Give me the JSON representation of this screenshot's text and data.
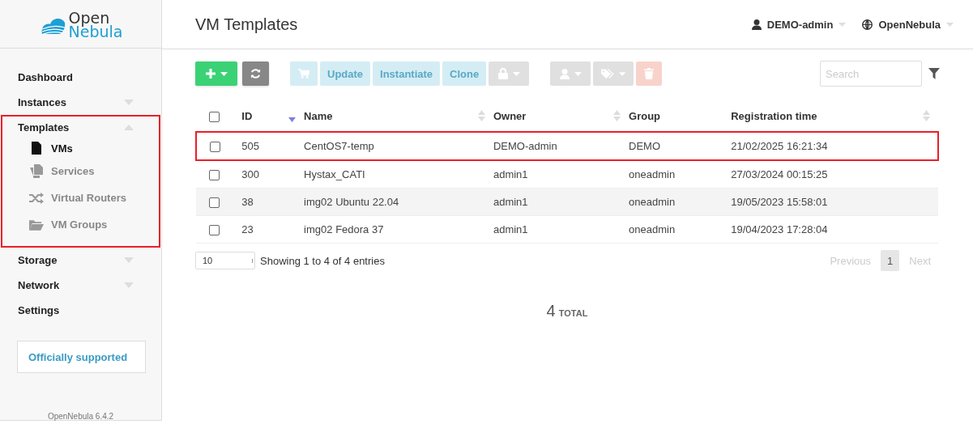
{
  "logo": {
    "line1": "Open",
    "line2": "Nebula"
  },
  "sidebar": {
    "items": [
      {
        "label": "Dashboard",
        "highlighted": false
      },
      {
        "label": "Instances",
        "expanded": false,
        "highlighted": false
      },
      {
        "label": "Templates",
        "expanded": true,
        "highlighted": true,
        "children": [
          {
            "label": "VMs",
            "kind": "file",
            "selected": true
          },
          {
            "label": "Services",
            "kind": "copy",
            "selected": false
          },
          {
            "label": "Virtual Routers",
            "kind": "shuffle",
            "selected": false
          },
          {
            "label": "VM Groups",
            "kind": "folder",
            "selected": false
          }
        ]
      },
      {
        "label": "Storage",
        "expanded": false,
        "highlighted": false
      },
      {
        "label": "Network",
        "expanded": false,
        "highlighted": false
      },
      {
        "label": "Settings",
        "highlighted": false
      }
    ],
    "support": "Officially supported",
    "version": "OpenNebula 6.4.2"
  },
  "header": {
    "title": "VM Templates",
    "user": "DEMO-admin",
    "zone": "OpenNebula"
  },
  "toolbar": [
    {
      "kind": "create",
      "disabled": false
    },
    {
      "kind": "refresh",
      "disabled": false
    },
    {
      "kind": "cart",
      "disabled": true
    },
    {
      "kind": "text",
      "label": "Update",
      "disabled": true
    },
    {
      "kind": "text",
      "label": "Instantiate",
      "disabled": true
    },
    {
      "kind": "text",
      "label": "Clone",
      "disabled": true
    },
    {
      "kind": "lock",
      "disabled": true
    },
    {
      "kind": "user",
      "disabled": true
    },
    {
      "kind": "tag",
      "disabled": true
    },
    {
      "kind": "delete",
      "disabled": true
    }
  ],
  "search": {
    "placeholder": "Search"
  },
  "table": {
    "select_all_checked": false,
    "columns": [
      {
        "label": "ID",
        "sortable": true,
        "sorted": true
      },
      {
        "label": "Name",
        "sortable": true,
        "sorted": false
      },
      {
        "label": "Owner",
        "sortable": true,
        "sorted": false
      },
      {
        "label": "Group",
        "sortable": false,
        "sorted": false
      },
      {
        "label": "Registration time",
        "sortable": true,
        "sorted": false
      }
    ],
    "rows": [
      {
        "checked": false,
        "shaded": false,
        "highlighted": true,
        "cells": [
          "505",
          "CentOS7-temp",
          "DEMO-admin",
          "DEMO",
          "21/02/2025 16:21:34"
        ]
      },
      {
        "checked": false,
        "shaded": false,
        "highlighted": false,
        "cells": [
          "300",
          "Hystax_CATI",
          "admin1",
          "oneadmin",
          "27/03/2024 00:15:25"
        ]
      },
      {
        "checked": false,
        "shaded": true,
        "highlighted": false,
        "cells": [
          "38",
          "img02 Ubuntu 22.04",
          "admin1",
          "oneadmin",
          "19/05/2023 15:58:01"
        ]
      },
      {
        "checked": false,
        "shaded": false,
        "highlighted": false,
        "cells": [
          "23",
          "img02 Fedora 37",
          "admin1",
          "oneadmin",
          "19/04/2023 17:28:04"
        ]
      }
    ]
  },
  "footer": {
    "page_size": "10",
    "info": "Showing 1 to 4 of 4 entries",
    "pages": [
      {
        "label": "Previous",
        "disabled": true,
        "selected": false
      },
      {
        "label": "1",
        "disabled": false,
        "selected": true
      },
      {
        "label": "Next",
        "disabled": true,
        "selected": false
      }
    ]
  },
  "total": {
    "count": "4",
    "label": "TOTAL"
  }
}
